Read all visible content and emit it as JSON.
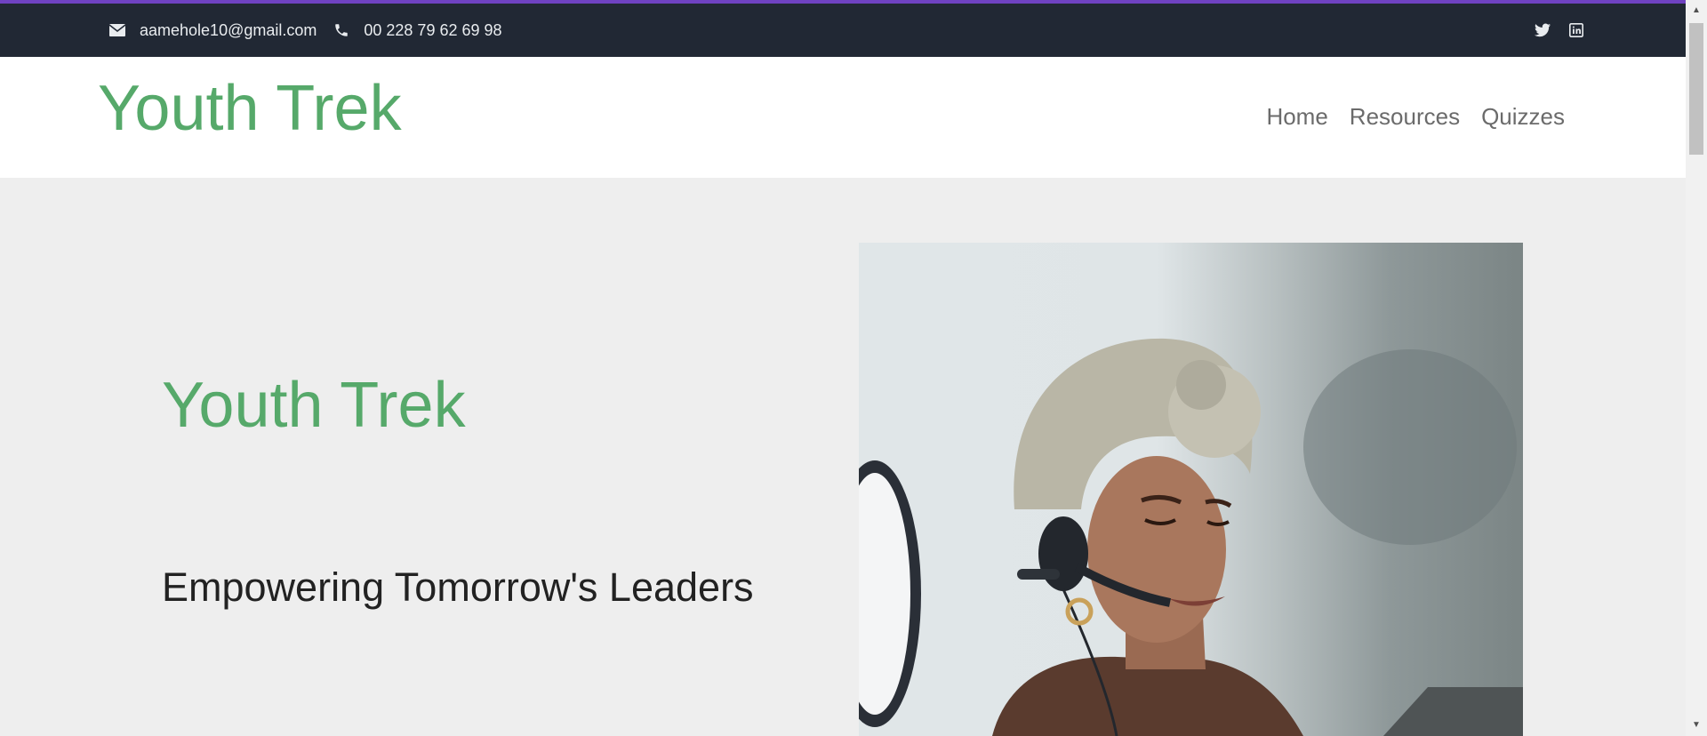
{
  "topbar": {
    "email": "aamehole10@gmail.com",
    "phone": "00 228 79 62 69 98",
    "icons": [
      "envelope-icon",
      "phone-icon",
      "twitter-icon",
      "linkedin-icon"
    ]
  },
  "navbar": {
    "brand": "Youth Trek",
    "links": [
      "Home",
      "Resources",
      "Quizzes"
    ]
  },
  "hero": {
    "title": "Youth Trek",
    "subtitle": "Empowering Tomorrow's Leaders"
  },
  "colors": {
    "brand_green": "#56a96a",
    "topbar_bg": "#212834",
    "accent_line": "#6f42c1",
    "hero_bg": "#eeeeee"
  }
}
